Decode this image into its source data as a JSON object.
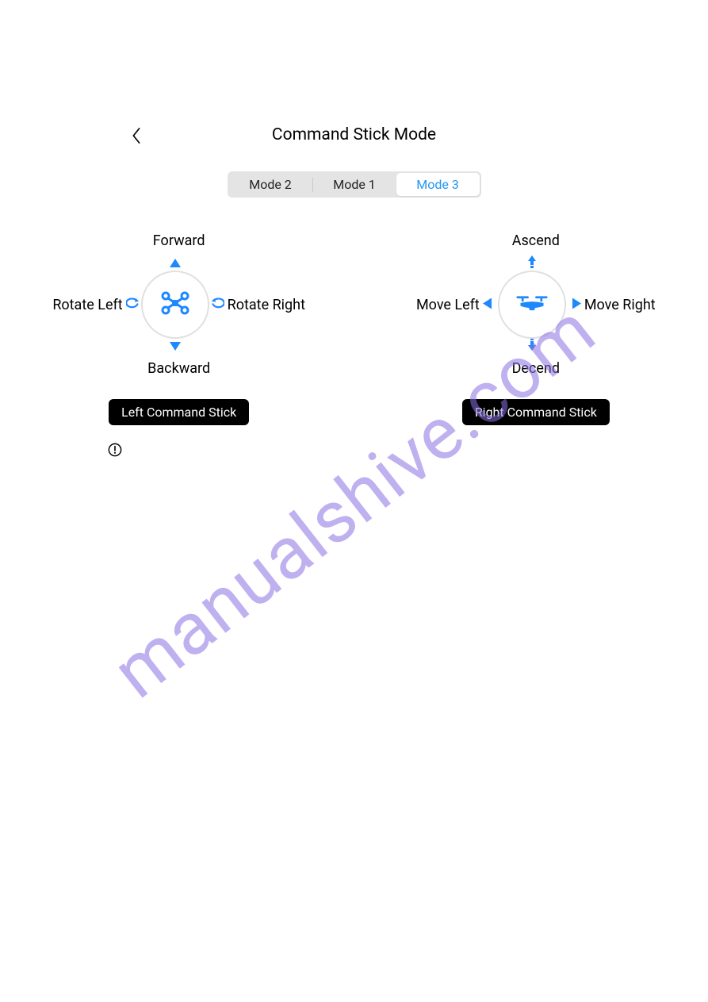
{
  "header": {
    "title": "Command Stick Mode"
  },
  "tabs": [
    "Mode 2",
    "Mode 1",
    "Mode 3"
  ],
  "active_tab_index": 2,
  "left_stick": {
    "top": "Forward",
    "bottom": "Backward",
    "left": "Rotate Left",
    "right": "Rotate Right",
    "pill": "Left Command Stick"
  },
  "right_stick": {
    "top": "Ascend",
    "bottom": "Decend",
    "left": "Move Left",
    "right": "Move Right",
    "pill": "Right Command Stick"
  },
  "watermark": "manualshive.com",
  "colors": {
    "accent": "#1e88ff",
    "tab_active_text": "#2196f3"
  }
}
